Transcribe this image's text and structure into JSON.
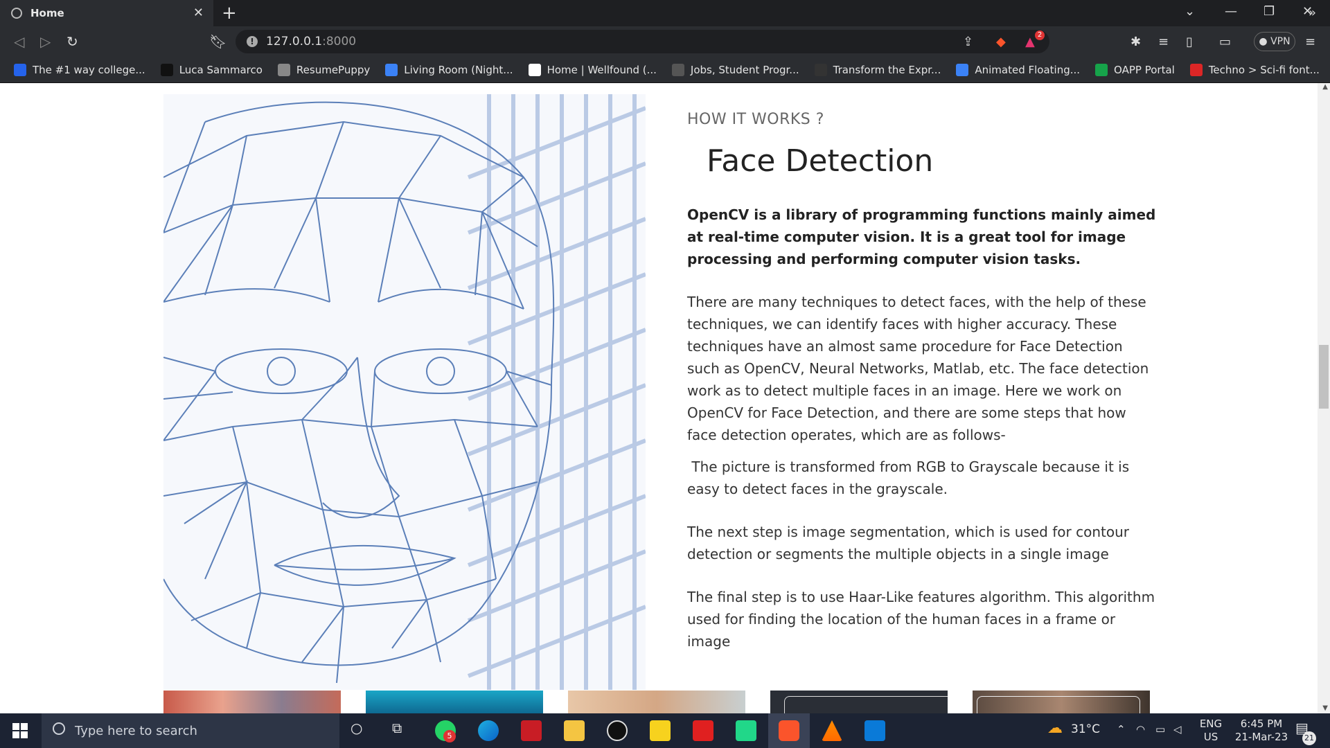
{
  "browser": {
    "tab_title": "Home",
    "url_host": "127.0.0.1",
    "url_port": ":8000",
    "vpn_label": "VPN",
    "brave_badge": "2",
    "bookmarks": [
      {
        "label": "The #1 way college...",
        "color": "#2563eb"
      },
      {
        "label": "Luca Sammarco",
        "color": "#111111"
      },
      {
        "label": "ResumePuppy",
        "color": "#888888"
      },
      {
        "label": "Living Room (Night...",
        "color": "#3b82f6"
      },
      {
        "label": "Home | Wellfound (...",
        "color": "#ffffff"
      },
      {
        "label": "Jobs, Student Progr...",
        "color": "#555555"
      },
      {
        "label": "Transform the Expr...",
        "color": "#333333"
      },
      {
        "label": "Animated Floating...",
        "color": "#3b82f6"
      },
      {
        "label": "OAPP Portal",
        "color": "#16a34a"
      },
      {
        "label": "Techno > Sci-fi font...",
        "color": "#dc2626"
      }
    ]
  },
  "page": {
    "eyebrow": "HOW IT WORKS ?",
    "heading": "Face Detection",
    "lead": "OpenCV is a library of programming functions mainly aimed at real-time computer vision. It is a great tool for image processing and performing computer vision tasks.",
    "para1": "There are many techniques to detect faces, with the help of these techniques, we can identify faces with higher accuracy. These techniques have an almost same procedure for Face Detection such as OpenCV, Neural Networks, Matlab, etc. The face detection work as to detect multiple faces in an image. Here we work on OpenCV for Face Detection, and there are some steps that how face detection operates, which are as follows-",
    "para2": " The picture is transformed from RGB to Grayscale because it is easy to detect faces in the grayscale.",
    "para3": "The next step is image segmentation, which is used for contour detection or segments the multiple objects in a single image",
    "para4": "The final step is to use Haar-Like features algorithm. This algorithm used for finding the location of the human faces in a frame or image"
  },
  "taskbar": {
    "search_placeholder": "Type here to search",
    "weather": "31°C",
    "lang_top": "ENG",
    "lang_bottom": "US",
    "time": "6:45 PM",
    "date": "21-Mar-23",
    "notif_count": "21",
    "whatsapp_badge": "5"
  },
  "colors": {
    "wire": "#5b7fb8",
    "accent_brave": "#fb542b"
  }
}
